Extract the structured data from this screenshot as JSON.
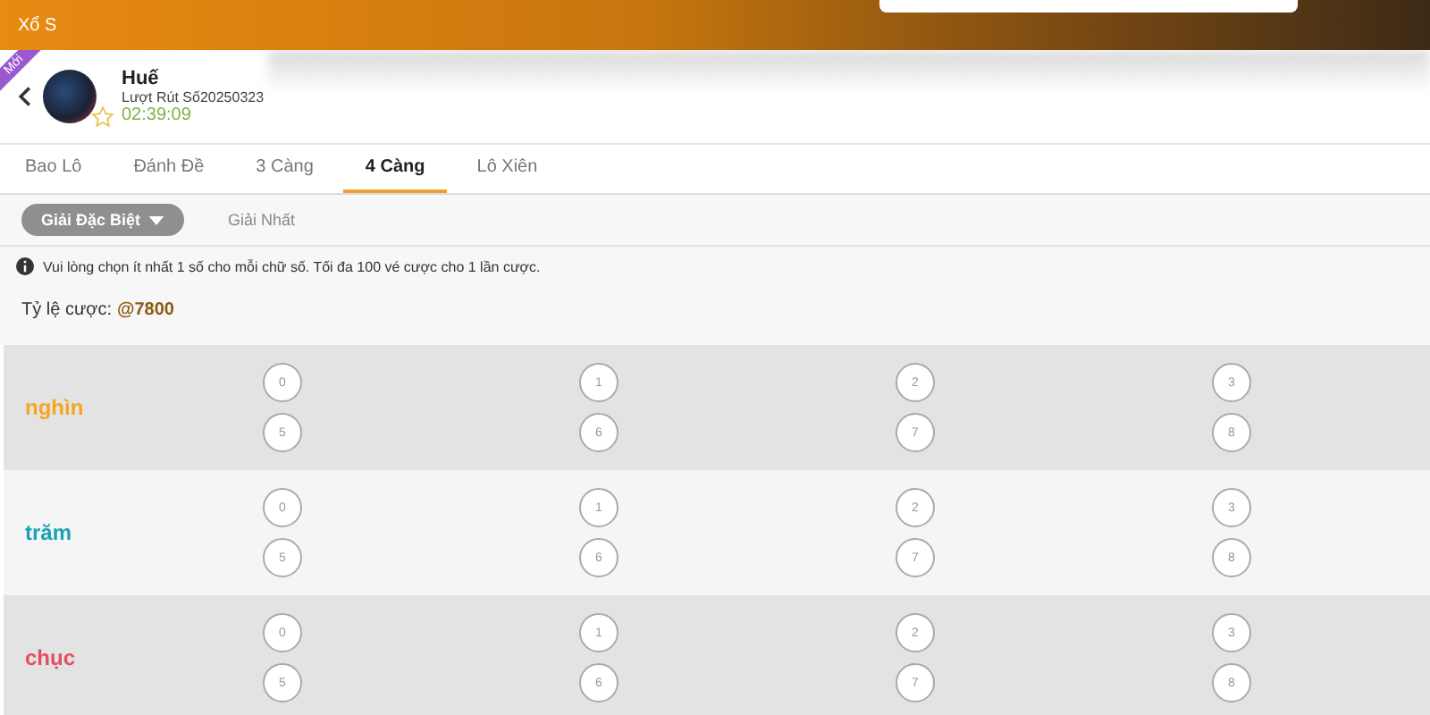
{
  "header": {
    "title": "Xổ S"
  },
  "lottery": {
    "badge": "Mới",
    "name": "Huế",
    "draw": "Lượt Rút Số20250323",
    "countdown": "02:39:09",
    "favorite": false
  },
  "tabs": [
    {
      "label": "Bao Lô",
      "selected": false
    },
    {
      "label": "Đánh Đề",
      "selected": false
    },
    {
      "label": "3 Càng",
      "selected": false
    },
    {
      "label": "4 Càng",
      "selected": true
    },
    {
      "label": "Lô Xiên",
      "selected": false
    }
  ],
  "prize_tabs": [
    {
      "label": "Giải Đặc Biệt",
      "selected": true
    },
    {
      "label": "Giải Nhất",
      "selected": false
    }
  ],
  "notice": "Vui lòng chọn ít nhất 1 số cho mỗi chữ số. Tối đa 100 vé cược cho 1 lần cược.",
  "odds": {
    "label": "Tỷ lệ cược:",
    "value": "@7800"
  },
  "positions": [
    {
      "label": "nghìn",
      "color": "#f5a623",
      "digits": [
        {
          "label": "0",
          "selected": false
        },
        {
          "label": "1",
          "selected": false
        },
        {
          "label": "2",
          "selected": false
        },
        {
          "label": "3",
          "selected": false
        },
        {
          "label": "5",
          "selected": false
        },
        {
          "label": "6",
          "selected": false
        },
        {
          "label": "7",
          "selected": false
        },
        {
          "label": "8",
          "selected": false
        }
      ]
    },
    {
      "label": "trăm",
      "color": "#1ba3b5",
      "digits": [
        {
          "label": "0",
          "selected": false
        },
        {
          "label": "1",
          "selected": false
        },
        {
          "label": "2",
          "selected": false
        },
        {
          "label": "3",
          "selected": false
        },
        {
          "label": "5",
          "selected": false
        },
        {
          "label": "6",
          "selected": false
        },
        {
          "label": "7",
          "selected": false
        },
        {
          "label": "8",
          "selected": false
        }
      ]
    },
    {
      "label": "chục",
      "color": "#e3505e",
      "digits": [
        {
          "label": "0",
          "selected": false
        },
        {
          "label": "1",
          "selected": false
        },
        {
          "label": "2",
          "selected": false
        },
        {
          "label": "3",
          "selected": false
        },
        {
          "label": "5",
          "selected": false
        },
        {
          "label": "6",
          "selected": false
        },
        {
          "label": "7",
          "selected": false
        },
        {
          "label": "8",
          "selected": false
        }
      ]
    }
  ]
}
